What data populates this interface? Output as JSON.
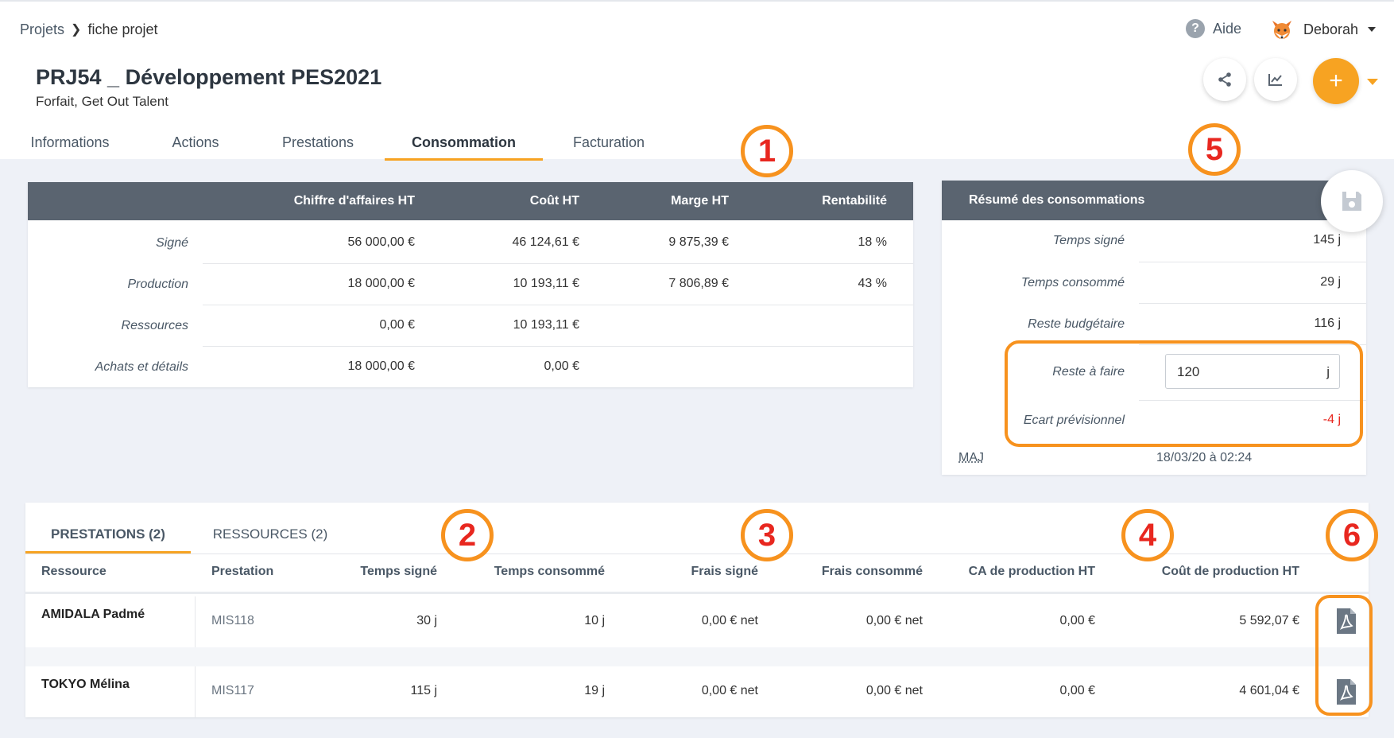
{
  "header": {
    "breadcrumb": {
      "parent": "Projets",
      "current": "fiche projet"
    },
    "help_label": "Aide",
    "user_name": "Deborah",
    "project_title": "PRJ54 _ Développement PES2021",
    "project_subtitle": "Forfait, Get Out Talent",
    "add_label": "+"
  },
  "tabs": [
    "Informations",
    "Actions",
    "Prestations",
    "Consommation",
    "Facturation"
  ],
  "finance": {
    "columns": [
      "Chiffre d'affaires HT",
      "Coût HT",
      "Marge HT",
      "Rentabilité"
    ],
    "rows": [
      {
        "label": "Signé",
        "ca": "56 000,00 €",
        "cout": "46 124,61 €",
        "marge": "9 875,39 €",
        "rent": "18 %"
      },
      {
        "label": "Production",
        "ca": "18 000,00 €",
        "cout": "10 193,11 €",
        "marge": "7 806,89 €",
        "rent": "43 %"
      },
      {
        "label": "Ressources",
        "ca": "0,00 €",
        "cout": "10 193,11 €",
        "marge": "",
        "rent": ""
      },
      {
        "label": "Achats et détails",
        "ca": "18 000,00 €",
        "cout": "0,00 €",
        "marge": "",
        "rent": ""
      }
    ]
  },
  "summary": {
    "title": "Résumé des consommations",
    "temps_signe_label": "Temps signé",
    "temps_signe": "145 j",
    "temps_consomme_label": "Temps consommé",
    "temps_consomme": "29 j",
    "reste_budgetaire_label": "Reste budgétaire",
    "reste_budgetaire": "116 j",
    "reste_a_faire_label": "Reste à faire",
    "reste_a_faire": "120",
    "reste_a_faire_unit": "j",
    "ecart_label": "Ecart prévisionnel",
    "ecart": "-4 j",
    "maj_label": "MAJ",
    "maj_value": "18/03/20 à 02:24",
    "ecart_color": "#e8271f"
  },
  "detail": {
    "tabs": [
      "PRESTATIONS (2)",
      "RESSOURCES (2)"
    ],
    "columns": [
      "Ressource",
      "Prestation",
      "Temps signé",
      "Temps consommé",
      "Frais signé",
      "Frais consommé",
      "CA de production HT",
      "Coût de production HT"
    ],
    "rows": [
      {
        "ressource": "AMIDALA Padmé",
        "prestation": "MIS118",
        "temps_signe": "30 j",
        "temps_consomme": "10 j",
        "frais_signe": "0,00 € net",
        "frais_consomme": "0,00 € net",
        "ca": "0,00 €",
        "cout": "5 592,07 €"
      },
      {
        "ressource": "TOKYO Mélina",
        "prestation": "MIS117",
        "temps_signe": "115 j",
        "temps_consomme": "19 j",
        "frais_signe": "0,00 € net",
        "frais_consomme": "0,00 € net",
        "ca": "0,00 €",
        "cout": "4 601,04 €"
      }
    ]
  },
  "badges": [
    "1",
    "2",
    "3",
    "4",
    "5",
    "6"
  ],
  "colors": {
    "accent": "#f7a322",
    "header_bg": "#5a6470",
    "highlight": "#f7921e",
    "badge_text": "#e8271f"
  }
}
